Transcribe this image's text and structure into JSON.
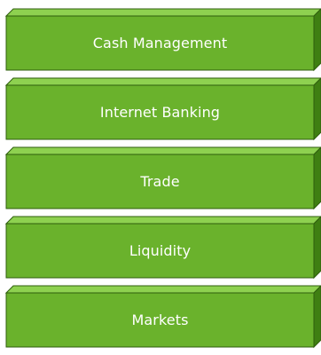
{
  "layers": [
    {
      "label": "Cash Management"
    },
    {
      "label": "Internet Banking"
    },
    {
      "label": "Trade"
    },
    {
      "label": "Liquidity"
    },
    {
      "label": "Markets"
    }
  ],
  "colors": {
    "front": "#6ab22c",
    "top": "#8ed150",
    "side": "#3f7f12",
    "outline": "#2f5e0d",
    "text": "#ffffff"
  }
}
